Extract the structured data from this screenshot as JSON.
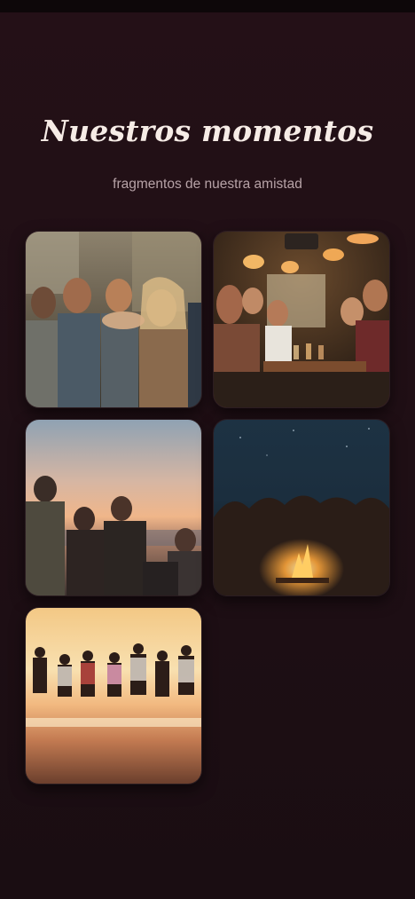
{
  "header": {
    "title": "Nuestros momentos",
    "subtitle": "fragmentos de nuestra amistad"
  },
  "gallery": {
    "photos": [
      {
        "subject": "friends toasting indoors"
      },
      {
        "subject": "friends at restaurant table"
      },
      {
        "subject": "friends on rooftop at sunset"
      },
      {
        "subject": "friends around campfire at night"
      },
      {
        "subject": "friends jumping on beach at sunset"
      }
    ]
  },
  "colors": {
    "background": "#211016",
    "title": "#f6ece6",
    "subtitle": "#b7a3a7"
  }
}
